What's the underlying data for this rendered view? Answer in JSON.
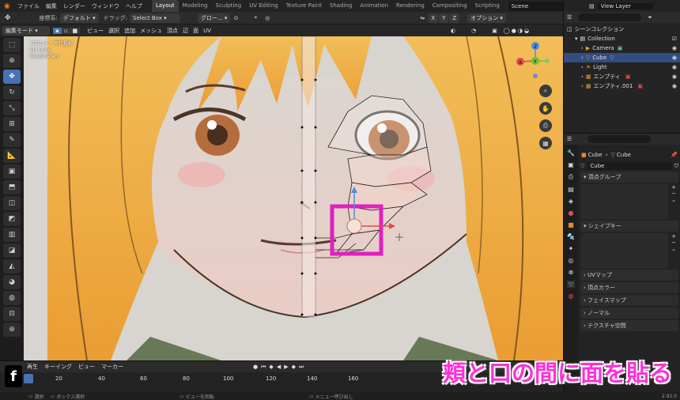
{
  "topbar": {
    "menu": [
      "ファイル",
      "編集",
      "レンダー",
      "ウィンドウ",
      "ヘルプ"
    ],
    "workspaces": [
      "Layout",
      "Modeling",
      "Sculpting",
      "UV Editing",
      "Texture Paint",
      "Shading",
      "Animation",
      "Rendering",
      "Compositing",
      "Scripting"
    ],
    "scene": "Scene",
    "view_layer": "View Layer"
  },
  "header": {
    "coord_label": "座標系:",
    "coord_value": "デフォルト",
    "drag_label": "ドラッグ:",
    "drag_value": "Select Box",
    "orient_value": "グロー...",
    "options": "オプション",
    "axes": [
      "X",
      "Y",
      "Z"
    ]
  },
  "header3": {
    "mode": "編集モード",
    "menus": [
      "ビュー",
      "選択",
      "追加",
      "メッシュ",
      "頂点",
      "辺",
      "面",
      "UV"
    ]
  },
  "viewport": {
    "info_line1": "フロント・平行投影",
    "info_line2": "(1) Cube",
    "info_line3": "Centimeters",
    "gizmo": {
      "x": "X",
      "y": "Y",
      "z": "Z"
    }
  },
  "outliner": {
    "title": "シーンコレクション",
    "items": [
      {
        "label": "Collection",
        "indent": 1
      },
      {
        "label": "Camera",
        "indent": 2
      },
      {
        "label": "Cube",
        "indent": 2,
        "selected": true
      },
      {
        "label": "Light",
        "indent": 2
      },
      {
        "label": "エンプティ",
        "indent": 2
      },
      {
        "label": "エンプティ.001",
        "indent": 2
      }
    ]
  },
  "properties": {
    "breadcrumb_obj": "Cube",
    "breadcrumb_mesh": "Cube",
    "mesh_name": "Cube",
    "vertex_groups": "頂点グループ",
    "shape_keys": "シェイプキー",
    "collapsed": [
      "UVマップ",
      "頂点カラー",
      "フェイスマップ",
      "ノーマル",
      "テクスチャ空間"
    ]
  },
  "timeline": {
    "menus": [
      "再生",
      "キーイング",
      "ビュー",
      "マーカー"
    ],
    "ticks": [
      "0",
      "20",
      "40",
      "60",
      "80",
      "100",
      "120",
      "140",
      "160"
    ]
  },
  "status": {
    "left": "選択",
    "box": "ボックス選択",
    "rotate": "ビューを回転",
    "menu": "メニュー呼び出し",
    "version": "2.92.0"
  },
  "caption": "頬と口の間に面を貼る",
  "badge": "f",
  "colors": {
    "accent": "#4772b3",
    "highlight": "#e020c0",
    "caption": "#ff2fd8"
  }
}
